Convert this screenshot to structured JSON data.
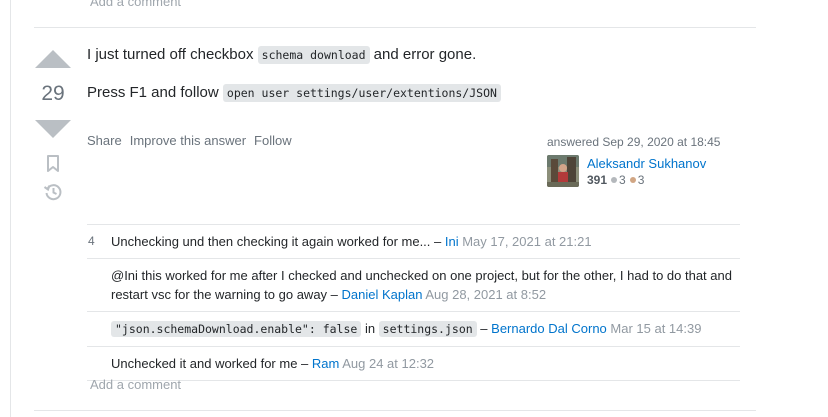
{
  "top": {
    "add_comment": "Add a comment"
  },
  "answer": {
    "score": "29",
    "para1_before": "I just turned off checkbox ",
    "para1_code": "schema download",
    "para1_after": " and error gone.",
    "para2_before": "Press F1 and follow ",
    "para2_code": "open user settings/user/extentions/JSON",
    "menu": {
      "share": "Share",
      "improve": "Improve this answer",
      "follow": "Follow"
    },
    "signature": {
      "action": "answered Sep 29, 2020 at 18:45",
      "user": "Aleksandr Sukhanov",
      "reputation": "391",
      "silver": "3",
      "bronze": "3"
    },
    "icons": {
      "vote_up": "triangle-up-icon",
      "vote_down": "triangle-down-icon",
      "bookmark": "bookmark-icon",
      "history": "history-icon"
    }
  },
  "comments": [
    {
      "score": "4",
      "text": "Unchecking und then checking it again worked for me... – ",
      "user": "Ini",
      "date": " May 17, 2021 at 21:21"
    },
    {
      "score": "",
      "text": "@Ini this worked for me after I checked and unchecked on one project, but for the other, I had to do that and restart vsc for the warning to go away – ",
      "user": "Daniel Kaplan",
      "date": " Aug 28, 2021 at 8:52"
    },
    {
      "score": "",
      "code1": "\"json.schemaDownload.enable\": false",
      "mid": " in ",
      "code2": "settings.json",
      "sep": " – ",
      "user": "Bernardo Dal Corno",
      "date": " Mar 15 at 14:39"
    },
    {
      "score": "",
      "text": "Unchecked it and worked for me – ",
      "user": "Ram",
      "date": " Aug 24 at 12:32"
    }
  ],
  "bottom": {
    "add_comment": "Add a comment"
  },
  "colors": {
    "link": "#0074cc",
    "silver": "#b4b8bc",
    "bronze": "#d1a684",
    "code_bg": "#e3e6e8"
  }
}
